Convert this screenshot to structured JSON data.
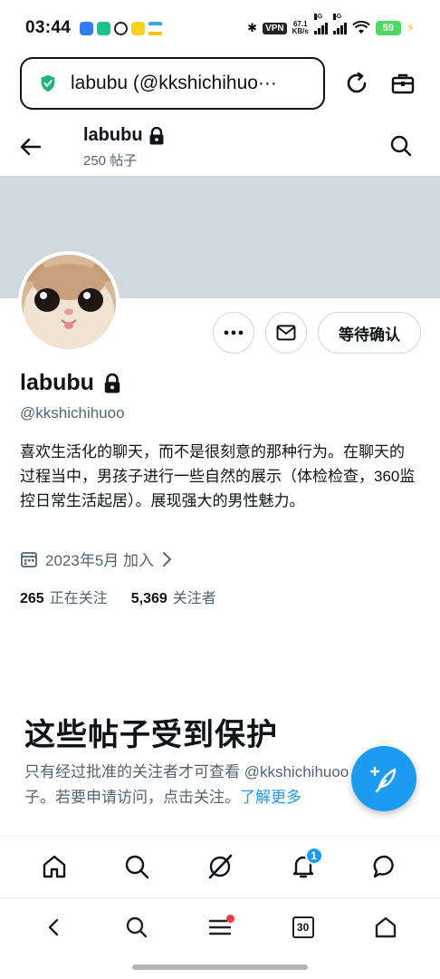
{
  "status_bar": {
    "time": "03:44",
    "vpn": "VPN",
    "speed_value": "67.1",
    "speed_unit": "KB/s",
    "signal_1": "4G",
    "signal_2": "4G",
    "battery": "59"
  },
  "browser": {
    "url_text": "labubu (@kkshichihuo···"
  },
  "header": {
    "name": "labubu",
    "post_count": "250 帖子"
  },
  "profile": {
    "name": "labubu",
    "handle": "@kkshichihuoo",
    "bio": "喜欢生活化的聊天，而不是很刻意的那种行为。在聊天的过程当中，男孩子进行一些自然的展示（体检检查，360监控日常生活起居）。展现强大的男性魅力。",
    "joined": "2023年5月 加入",
    "following_count": "265",
    "following_label": "正在关注",
    "followers_count": "5,369",
    "followers_label": "关注者",
    "pending_button": "等待确认"
  },
  "protected": {
    "title": "这些帖子受到保护",
    "desc": "只有经过批准的关注者才可查看 @kkshichihuoo 的帖子。若要申请访问，点击关注。",
    "link": "了解更多"
  },
  "tabbar": {
    "notif_badge": "1"
  },
  "browserbar": {
    "tab_count": "30"
  },
  "colors": {
    "accent": "#1d9bf0",
    "banner": "#cfd9de",
    "muted_text": "#536471"
  }
}
